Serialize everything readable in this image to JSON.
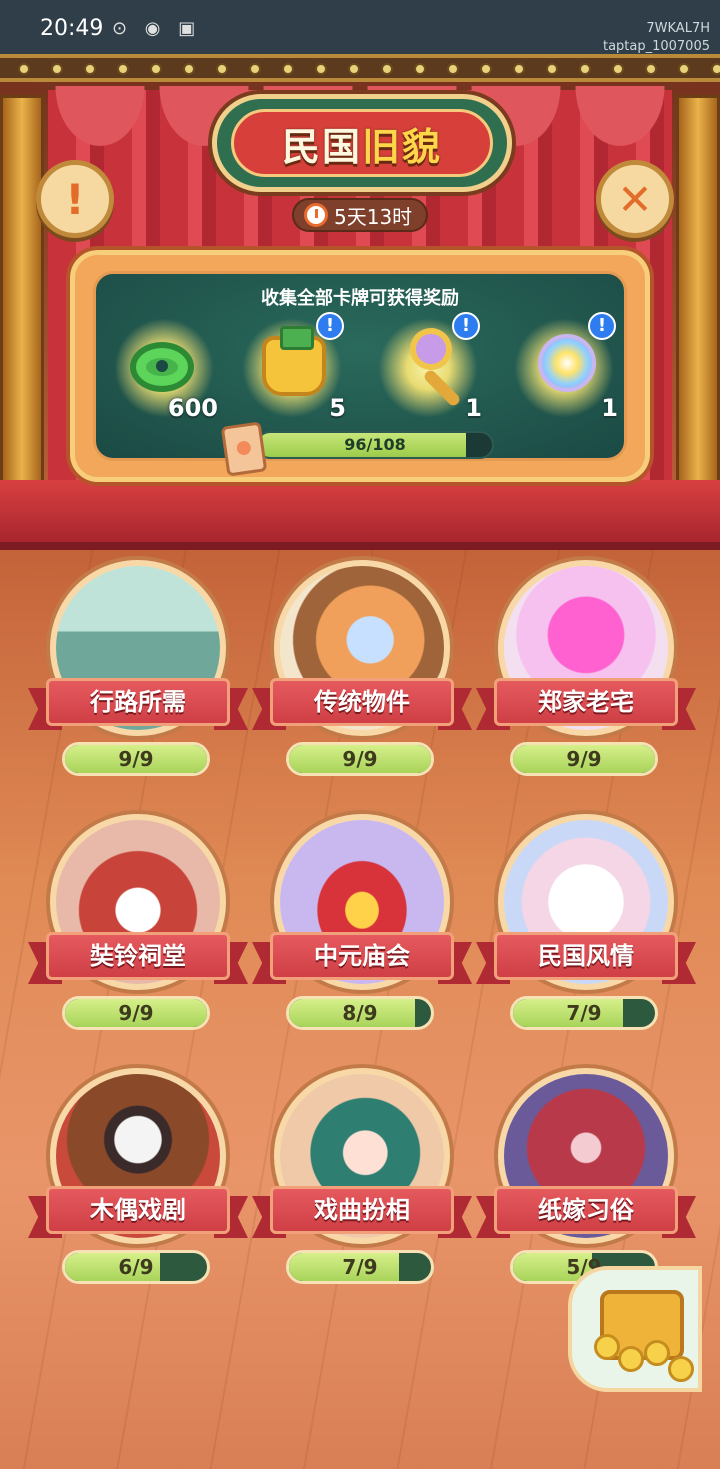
{
  "status_bar": {
    "time": "20:49",
    "watermark_line1": "7WKAL7H",
    "watermark_line2": "taptap_1007005"
  },
  "header": {
    "title_part1": "民国",
    "title_part2": "旧貌",
    "timer": "5天13时",
    "info_icon": "exclamation-icon",
    "close_icon": "close-icon"
  },
  "reward_panel": {
    "title": "收集全部卡牌可获得奖励",
    "rewards": [
      {
        "icon": "jade-coin-icon",
        "count": "600",
        "has_info": false
      },
      {
        "icon": "treasure-chest-icon",
        "count": "5",
        "has_info": true
      },
      {
        "icon": "golden-mirror-icon",
        "count": "1",
        "has_info": true
      },
      {
        "icon": "magic-orb-icon",
        "count": "1",
        "has_info": true
      }
    ],
    "progress": {
      "text": "96/108",
      "value": 96,
      "max": 108
    }
  },
  "categories": [
    {
      "label": "行路所需",
      "progress": "9/9",
      "value": 9,
      "max": 9,
      "art": "rickshaw"
    },
    {
      "label": "传统物件",
      "progress": "9/9",
      "value": 9,
      "max": 9,
      "art": "box"
    },
    {
      "label": "郑家老宅",
      "progress": "9/9",
      "value": 9,
      "max": 9,
      "art": "flower"
    },
    {
      "label": "奘铃祠堂",
      "progress": "9/9",
      "value": 9,
      "max": 9,
      "art": "altar"
    },
    {
      "label": "中元庙会",
      "progress": "8/9",
      "value": 8,
      "max": 9,
      "art": "lantern"
    },
    {
      "label": "民国风情",
      "progress": "7/9",
      "value": 7,
      "max": 9,
      "art": "gloves"
    },
    {
      "label": "木偶戏剧",
      "progress": "6/9",
      "value": 6,
      "max": 9,
      "art": "puppet"
    },
    {
      "label": "戏曲扮相",
      "progress": "7/9",
      "value": 7,
      "max": 9,
      "art": "opera"
    },
    {
      "label": "纸嫁习俗",
      "progress": "5/9",
      "value": 5,
      "max": 9,
      "art": "bride"
    }
  ],
  "treasure_button": {
    "icon": "treasure-chest-icon"
  },
  "colors": {
    "accent_red": "#d63f3a",
    "panel_teal": "#1b4a44",
    "progress_green": "#a8d45a"
  }
}
